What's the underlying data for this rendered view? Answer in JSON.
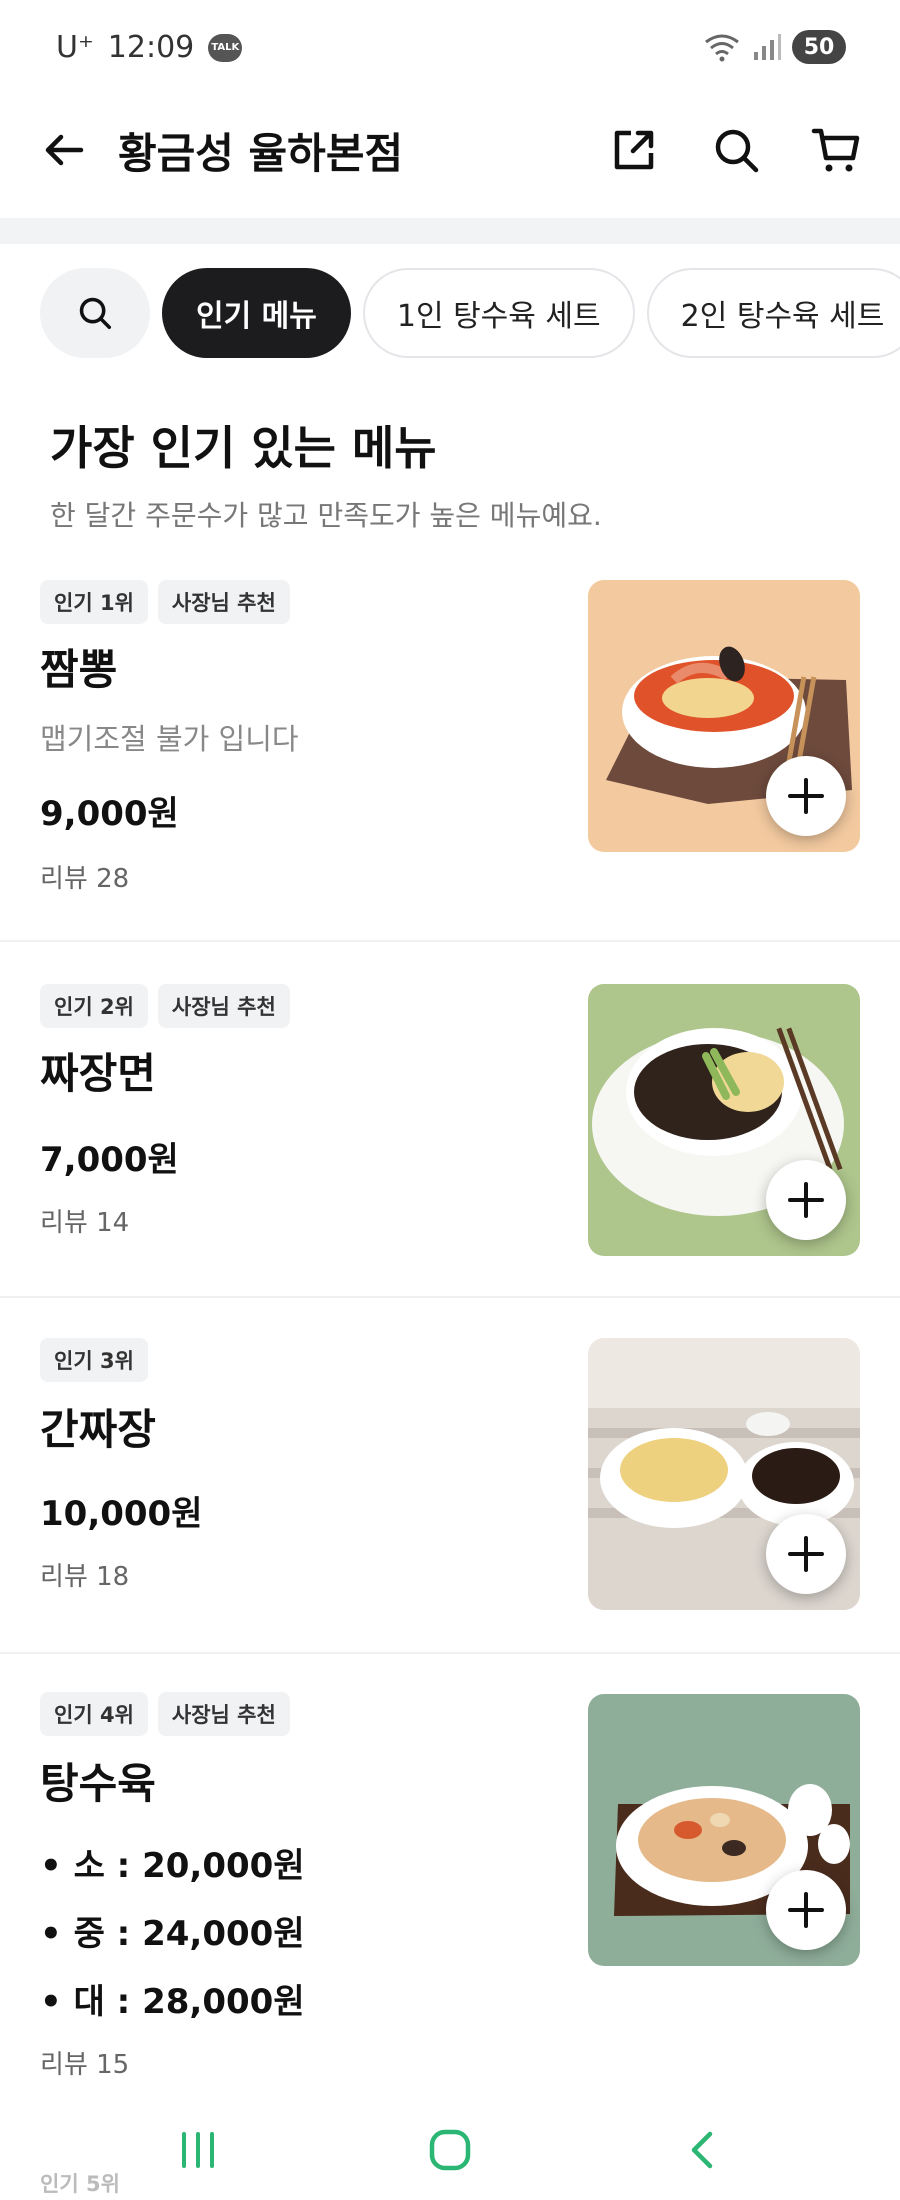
{
  "status_bar": {
    "carrier": "U⁺",
    "time": "12:09",
    "talk_label": "TALK",
    "battery": "50"
  },
  "header": {
    "title": "황금성 율하본점"
  },
  "chips": [
    "인기 메뉴",
    "1인 탕수육 세트",
    "2인 탕수육 세트"
  ],
  "section": {
    "title": "가장 인기 있는 메뉴",
    "subtitle": "한 달간 주문수가 많고 만족도가 높은 메뉴예요."
  },
  "items": [
    {
      "badges": [
        "인기 1위",
        "사장님 추천"
      ],
      "name": "짬뽕",
      "desc": "맵기조절 불가 입니다",
      "price": "9,000원",
      "review": "리뷰 28"
    },
    {
      "badges": [
        "인기 2위",
        "사장님 추천"
      ],
      "name": "짜장면",
      "price": "7,000원",
      "review": "리뷰 14"
    },
    {
      "badges": [
        "인기 3위"
      ],
      "name": "간짜장",
      "price": "10,000원",
      "review": "리뷰 18"
    },
    {
      "badges": [
        "인기 4위",
        "사장님 추천"
      ],
      "name": "탕수육",
      "price_lines": [
        "• 소 : 20,000원",
        "• 중 : 24,000원",
        "• 대 : 28,000원"
      ],
      "review": "리뷰 15"
    }
  ],
  "peek_label": "인기 5위",
  "colors": {
    "accent_dark": "#1c1c1e",
    "chip_bg": "#f1f2f4",
    "nav_green": "#2bb673"
  },
  "icons": [
    "back-arrow-icon",
    "share-icon",
    "search-icon",
    "cart-icon",
    "plus-icon",
    "recents-icon",
    "home-icon",
    "nav-back-icon"
  ]
}
